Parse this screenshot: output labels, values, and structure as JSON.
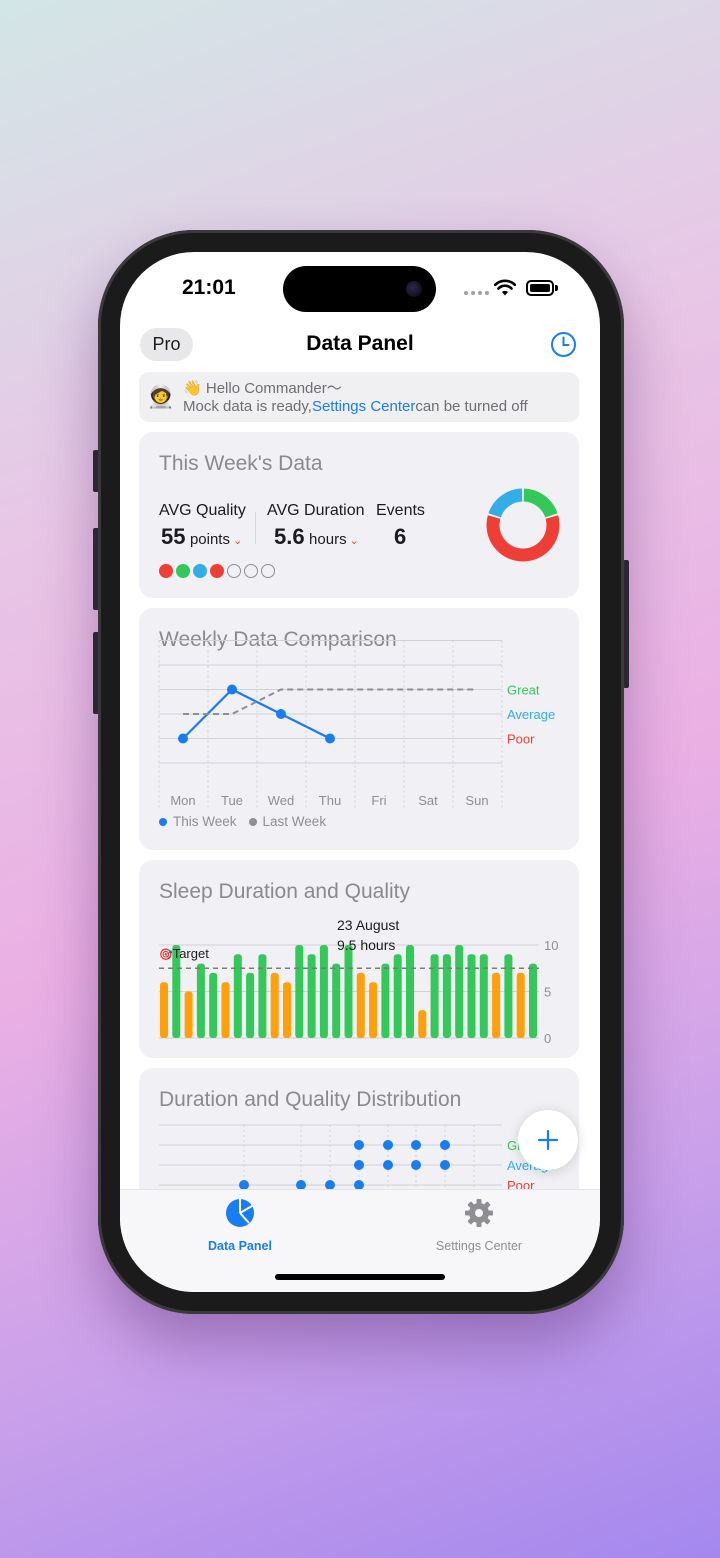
{
  "status_bar": {
    "time": "21:01"
  },
  "header": {
    "pro_label": "Pro",
    "title": "Data Panel",
    "history_icon": "clock-icon"
  },
  "banner": {
    "avatar_emoji": "🧑‍🚀",
    "wave_emoji": "👋",
    "greeting": "Hello Commander～",
    "message_prefix": "Mock data is ready,",
    "link_text": "Settings Center",
    "message_suffix": "can be turned off"
  },
  "weekly_card": {
    "title": "This Week's Data",
    "avg_quality_label": "AVG Quality",
    "avg_quality_value": "55",
    "avg_quality_unit": "points",
    "avg_duration_label": "AVG Duration",
    "avg_duration_value": "5.6",
    "avg_duration_unit": "hours",
    "events_label": "Events",
    "events_value": "6",
    "trend_arrow": "⌄",
    "day_dots": [
      "#ef3e36",
      "#34c759",
      "#32ade6",
      "#ef3e36",
      "empty",
      "empty",
      "empty"
    ],
    "donut_segments": [
      {
        "color": "#34c759",
        "fraction": 0.17
      },
      {
        "color": "#ef3e36",
        "fraction": 0.5
      },
      {
        "color": "#32ade6",
        "fraction": 0.17
      }
    ]
  },
  "comparison_card": {
    "title": "Weekly Data Comparison",
    "quality_labels": [
      {
        "text": "Great",
        "color": "#34c759"
      },
      {
        "text": "Average",
        "color": "#32ade6"
      },
      {
        "text": "Poor",
        "color": "#ef3e36"
      }
    ],
    "legend": [
      {
        "text": "This Week",
        "color": "#1a7cf2"
      },
      {
        "text": "Last Week",
        "color": "#8e8e93"
      }
    ]
  },
  "sleep_card": {
    "title": "Sleep Duration and Quality",
    "tooltip_date": "23 August",
    "tooltip_hours": "9.5 hours",
    "target_label": "Target",
    "target_emoji": "🎯"
  },
  "distribution_card": {
    "title": "Duration and Quality Distribution",
    "quality_labels": [
      {
        "text": "Great",
        "color": "#34c759"
      },
      {
        "text": "Average",
        "color": "#32ade6"
      },
      {
        "text": "Poor",
        "color": "#ef3e36"
      }
    ]
  },
  "tabbar": {
    "tabs": [
      {
        "label": "Data Panel",
        "icon": "pie-chart-icon",
        "active": true
      },
      {
        "label": "Settings Center",
        "icon": "gear-icon",
        "active": false
      }
    ]
  },
  "fab": {
    "icon": "plus-icon"
  },
  "chart_data": [
    {
      "type": "line",
      "categories": [
        "Mon",
        "Tue",
        "Wed",
        "Thu",
        "Fri",
        "Sat",
        "Sun"
      ],
      "y_categories": [
        "Poor",
        "Average",
        "Great"
      ],
      "series": [
        {
          "name": "This Week",
          "values": [
            1,
            3,
            2,
            1,
            null,
            null,
            null
          ],
          "color": "#1a7cf2"
        },
        {
          "name": "Last Week",
          "values": [
            2,
            2,
            3,
            3,
            3,
            3,
            3
          ],
          "color": "#8e8e93",
          "dashed": true
        }
      ]
    },
    {
      "type": "bar",
      "ylim": [
        0,
        10
      ],
      "y_ticks": [
        0,
        5,
        10
      ],
      "target": 7.5,
      "values": [
        6,
        10,
        5,
        8,
        7,
        6,
        9,
        7,
        9,
        7,
        6,
        10,
        9,
        10,
        8,
        10,
        7,
        6,
        8,
        9,
        10,
        3,
        9,
        9,
        10,
        9,
        9,
        7,
        9,
        7,
        8
      ],
      "quality": [
        "a",
        "g",
        "a",
        "g",
        "g",
        "a",
        "g",
        "g",
        "g",
        "a",
        "a",
        "g",
        "g",
        "g",
        "g",
        "g",
        "a",
        "a",
        "g",
        "g",
        "g",
        "a",
        "g",
        "g",
        "g",
        "g",
        "g",
        "a",
        "g",
        "a",
        "g"
      ]
    },
    {
      "type": "scatter",
      "y_categories": [
        "Poor",
        "Average",
        "Great"
      ]
    }
  ]
}
